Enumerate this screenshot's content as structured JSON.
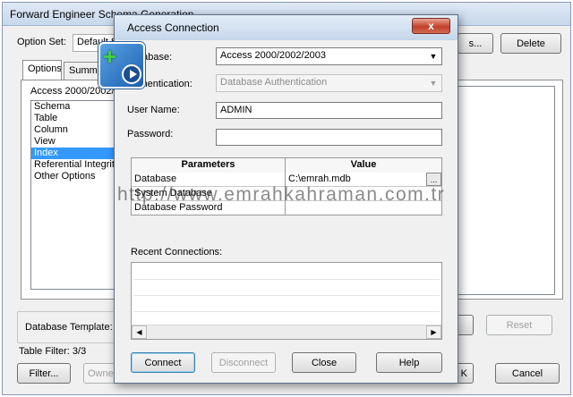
{
  "background_window": {
    "title": "Forward Engineer Schema Generation",
    "option_set_label": "Option Set:",
    "option_set_value": "Default S",
    "save_as_label": "s...",
    "delete_label": "Delete",
    "tabs": [
      "Options",
      "Summar"
    ],
    "panel_heading": "Access 2000/2002/",
    "tree_items": [
      "Schema",
      "Table",
      "Column",
      "View",
      "Index",
      "Referential Integrity",
      "Other Options"
    ],
    "selected_tree_item": "Index",
    "database_template_label": "Database Template:",
    "reset_label": "Reset",
    "table_filter": "Table Filter: 3/3",
    "filter_label": "Filter...",
    "owner_label": "Owner",
    "ok_label": "K",
    "cancel_label": "Cancel"
  },
  "dialog": {
    "title": "Access Connection",
    "close_glyph": "x",
    "database_label": "Database:",
    "database_value": "Access 2000/2002/2003",
    "authentication_label": "Authentication:",
    "authentication_value": "Database Authentication",
    "username_label": "User Name:",
    "username_value": "ADMIN",
    "password_label": "Password:",
    "password_value": "",
    "parameters": {
      "headers": [
        "Parameters",
        "Value"
      ],
      "rows": [
        {
          "name": "Database",
          "value": "C:\\emrah.mdb"
        },
        {
          "name": "System Database",
          "value": ""
        },
        {
          "name": "Database Password",
          "value": ""
        }
      ],
      "browse_label": "..."
    },
    "recent_label": "Recent Connections:",
    "buttons": {
      "connect": "Connect",
      "disconnect": "Disconnect",
      "close": "Close",
      "help": "Help"
    }
  },
  "watermark": "http://www.emrahkahraman.com.tr",
  "icons": {
    "connect_icon": "add-connection-icon",
    "dropdown": "chevron-down-icon",
    "scroll_left": "scroll-left-icon",
    "scroll_right": "scroll-right-icon"
  },
  "colors": {
    "selection": "#3399ff",
    "close_button": "#c4412a",
    "titlebar": "#c5d6ea"
  }
}
